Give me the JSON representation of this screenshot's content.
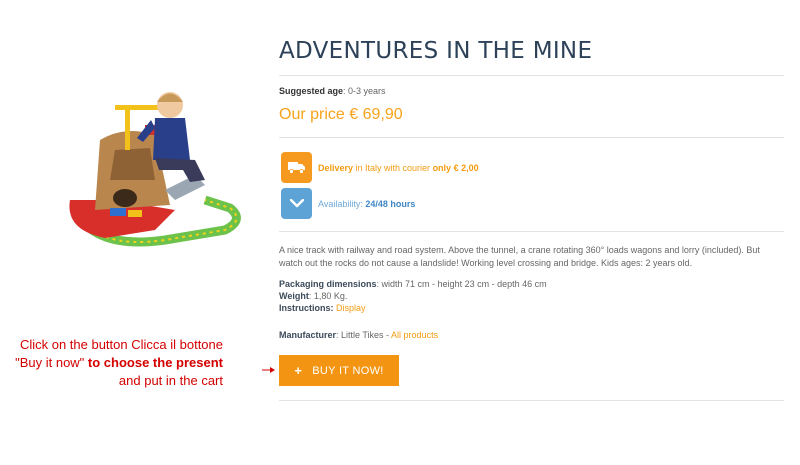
{
  "product": {
    "title": "ADVENTURES IN THE MINE",
    "age_label": "Suggested age",
    "age_value": ": 0-3 years",
    "price": "Our price € 69,90",
    "delivery": {
      "highlight": "Delivery",
      "text": " in Italy with courier ",
      "cost": "only € 2,00"
    },
    "availability": {
      "label": "Availability: ",
      "value": "24/48 hours"
    },
    "description": "A nice track with railway and road system. Above the tunnel, a crane rotating 360° loads wagons and lorry (included). But watch out the rocks do not cause a landslide! Working level crossing and bridge. Kids ages: 2 years old.",
    "packaging_label": "Packaging dimensions",
    "packaging_value": ": width 71 cm - height 23 cm - depth 46 cm",
    "weight_label": "Weight",
    "weight_value": ": 1,80 Kg.",
    "instructions_label": "Instructions:",
    "instructions_link": "Display",
    "manufacturer_label": "Manufacturer",
    "manufacturer_value": ": Little Tikes - ",
    "all_products_link": "All products"
  },
  "buy_button": {
    "icon": "plus-icon",
    "label": "BUY IT NOW!"
  },
  "callout": {
    "line1": "Click on the button Clicca il bottone \"Buy it now\" ",
    "bold1": "to choose the present",
    "line2": " and put in the cart"
  },
  "colors": {
    "accent": "#f39512",
    "title": "#2d4258",
    "callout": "#d40000",
    "availability_badge": "#5ea3d6"
  }
}
